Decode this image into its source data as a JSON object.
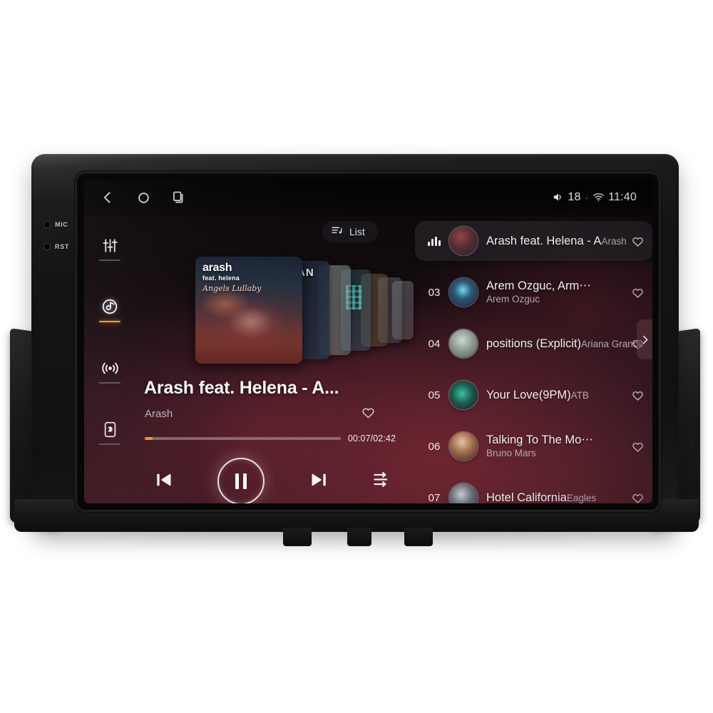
{
  "device": {
    "bezel_labels": [
      {
        "name": "mic",
        "text": "MIC"
      },
      {
        "name": "rst",
        "text": "RST"
      }
    ]
  },
  "statusbar": {
    "nav": [
      {
        "name": "back",
        "icon": "chevron-left-icon"
      },
      {
        "name": "home",
        "icon": "circle-home-icon"
      },
      {
        "name": "recents",
        "icon": "recent-apps-icon"
      }
    ],
    "volume_icon": "speaker-icon",
    "volume_value": "18",
    "separator": "·",
    "wifi_icon": "wifi-icon",
    "clock": "11:40"
  },
  "rail": {
    "items": [
      {
        "label": "equalizer",
        "icon": "equalizer-sliders-icon",
        "active": false
      },
      {
        "label": "music-disc",
        "icon": "disc-player-icon",
        "active": true
      },
      {
        "label": "radio",
        "icon": "radio-waves-icon",
        "active": false
      },
      {
        "label": "bluetooth",
        "icon": "bluetooth-phone-icon",
        "active": false
      }
    ]
  },
  "player": {
    "list_button": {
      "label": "List",
      "icon": "playlist-icon"
    },
    "album": {
      "title": "arash",
      "subtitle": "feat. helena",
      "script": "Angels Lullaby",
      "stack_letter": "AN"
    },
    "now_playing": {
      "title": "Arash feat. Helena - A...",
      "artist": "Arash",
      "elapsed": "00:07",
      "duration": "02:42",
      "time_display": "00:07/02:42",
      "progress_percent": 4,
      "favorite": false,
      "favorite_icon": "heart-outline-icon"
    },
    "controls": [
      {
        "name": "previous-track",
        "icon": "skip-previous-icon"
      },
      {
        "name": "play-pause",
        "icon": "pause-icon",
        "state": "playing"
      },
      {
        "name": "next-track",
        "icon": "skip-next-icon"
      },
      {
        "name": "play-mode",
        "icon": "shuffle-order-icon"
      }
    ]
  },
  "playlist": {
    "edge_tab_icon": "chevron-right-icon",
    "rows": [
      {
        "index": "",
        "playing": true,
        "title": "Arash feat. Helena - A",
        "artist": "Arash",
        "thumb": "th-0",
        "favorite_icon": "heart-outline-icon"
      },
      {
        "index": "03",
        "playing": false,
        "title": "Arem Ozguc, Arm⋯",
        "artist": "Arem Ozguc",
        "thumb": "th-1",
        "favorite_icon": "heart-outline-icon"
      },
      {
        "index": "04",
        "playing": false,
        "title": "positions (Explicit)",
        "artist": "Ariana Grande",
        "thumb": "th-2",
        "favorite_icon": "heart-outline-icon"
      },
      {
        "index": "05",
        "playing": false,
        "title": "Your Love(9PM)",
        "artist": "ATB",
        "thumb": "th-3",
        "favorite_icon": "heart-outline-icon"
      },
      {
        "index": "06",
        "playing": false,
        "title": "Talking To The Mo⋯",
        "artist": "Bruno Mars",
        "thumb": "th-4",
        "favorite_icon": "heart-outline-icon"
      },
      {
        "index": "07",
        "playing": false,
        "title": "Hotel California",
        "artist": "Eagles",
        "thumb": "th-5",
        "favorite_icon": "heart-outline-icon"
      }
    ]
  },
  "colors": {
    "accent": "#f09820",
    "screen_base": "#140c0f",
    "screen_glow": "#6e2530",
    "text_primary": "#f3f0f2",
    "text_secondary": "#b4a9ae"
  }
}
